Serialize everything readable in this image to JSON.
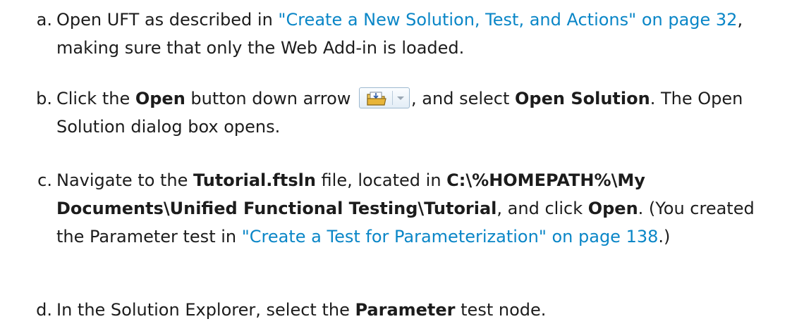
{
  "steps": [
    {
      "marker": "a.",
      "line1_text1": "Open UFT as described in ",
      "line1_link": "\"Create a New Solution, Test, and Actions\" on page 32",
      "line1_text2": ",",
      "line2_text": "making sure that only the Web Add-in is loaded."
    },
    {
      "marker": "b.",
      "line1_text1": "Click the ",
      "line1_bold1": "Open",
      "line1_text2": " button down arrow ",
      "button_icon": "open-folder-icon",
      "line1_text3": ", and select ",
      "line1_bold2": "Open Solution",
      "line1_text4": ". The Open",
      "line2_text": "Solution dialog box opens."
    },
    {
      "marker": "c.",
      "line1_text1": "Navigate to the ",
      "line1_bold1": "Tutorial.ftsln",
      "line1_text2": " file, located in ",
      "line1_bold2": "C:\\%HOMEPATH%\\My",
      "line2_bold": "Documents\\Unified Functional Testing\\Tutorial",
      "line2_text1": ", and click ",
      "line2_bold2": "Open",
      "line2_text2": ". (You created",
      "line3_text1": "the Parameter test in ",
      "line3_link": "\"Create a Test for Parameterization\" on page 138",
      "line3_text2": ".)"
    },
    {
      "marker": "d.",
      "line1_text1": "In the Solution Explorer, select the ",
      "line1_bold": "Parameter",
      "line1_text2": " test node."
    }
  ],
  "colors": {
    "text": "#1c1c1c",
    "link": "#0a86c7",
    "button_border": "#9db8cf",
    "folder": "#e8b53a"
  }
}
